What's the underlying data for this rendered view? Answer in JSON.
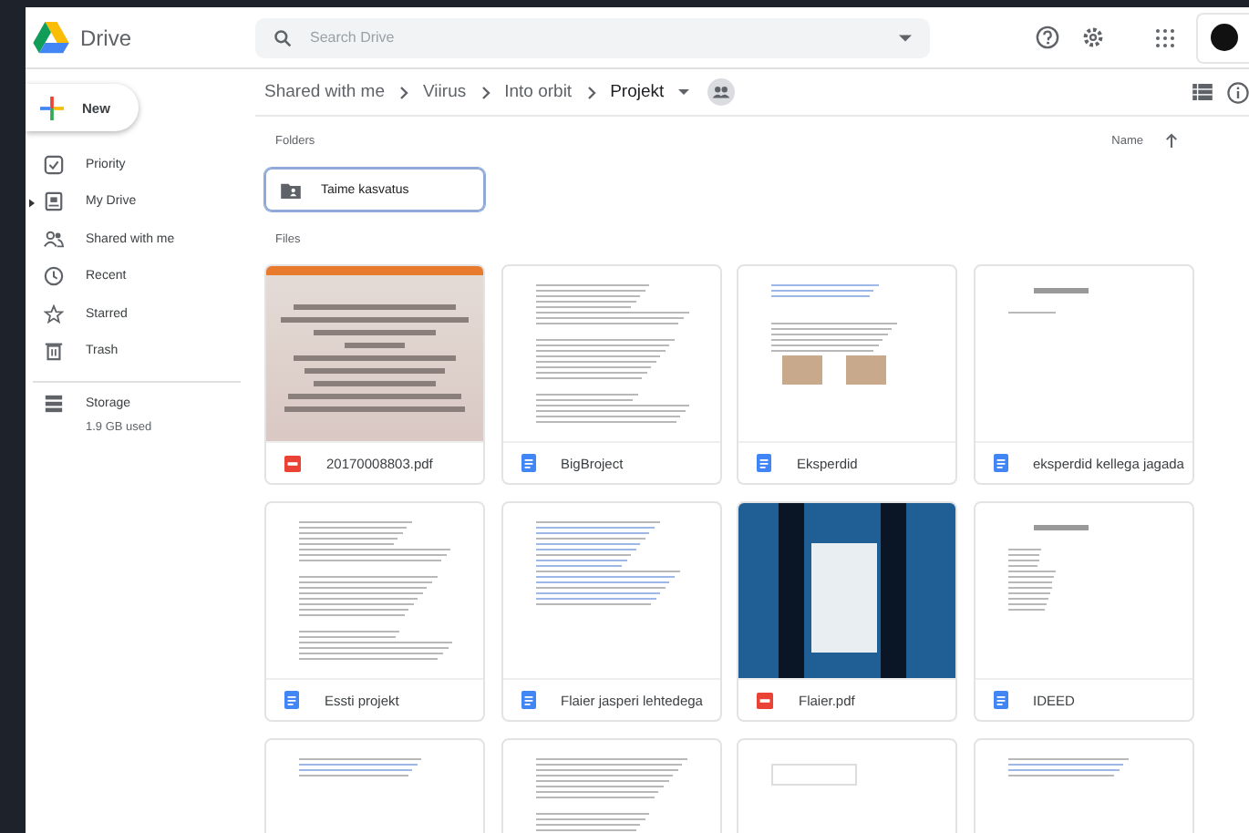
{
  "header": {
    "app_name": "Drive",
    "search": {
      "placeholder": "Search Drive"
    }
  },
  "sidebar": {
    "new_button": "New",
    "items": [
      {
        "label": "Priority",
        "expandable": false
      },
      {
        "label": "My Drive",
        "expandable": true
      },
      {
        "label": "Shared with me",
        "expandable": false
      },
      {
        "label": "Recent",
        "expandable": false
      },
      {
        "label": "Starred",
        "expandable": false
      },
      {
        "label": "Trash",
        "expandable": false
      }
    ],
    "storage": {
      "label": "Storage",
      "usage": "1.9 GB used"
    }
  },
  "breadcrumb": [
    "Shared with me",
    "Viirus",
    "Into orbit",
    "Projekt"
  ],
  "folders_section": {
    "label": "Folders",
    "sort": "Name",
    "folders": [
      {
        "name": "Taime kasvatus",
        "selected": true
      }
    ]
  },
  "files_section": {
    "label": "Files",
    "files": [
      {
        "name": "20170008803.pdf",
        "kind": "pdf"
      },
      {
        "name": "BigBroject",
        "kind": "doc"
      },
      {
        "name": "Eksperdid",
        "kind": "doc"
      },
      {
        "name": "eksperdid kellega jagada",
        "kind": "doc"
      },
      {
        "name": "Essti projekt",
        "kind": "doc"
      },
      {
        "name": "Flaier jasperi lehtedega",
        "kind": "doc"
      },
      {
        "name": "Flaier.pdf",
        "kind": "pdf"
      },
      {
        "name": "IDEED",
        "kind": "doc"
      },
      {
        "kind": "clipped"
      },
      {
        "kind": "clipped"
      },
      {
        "kind": "clipped"
      },
      {
        "kind": "clipped"
      }
    ]
  }
}
